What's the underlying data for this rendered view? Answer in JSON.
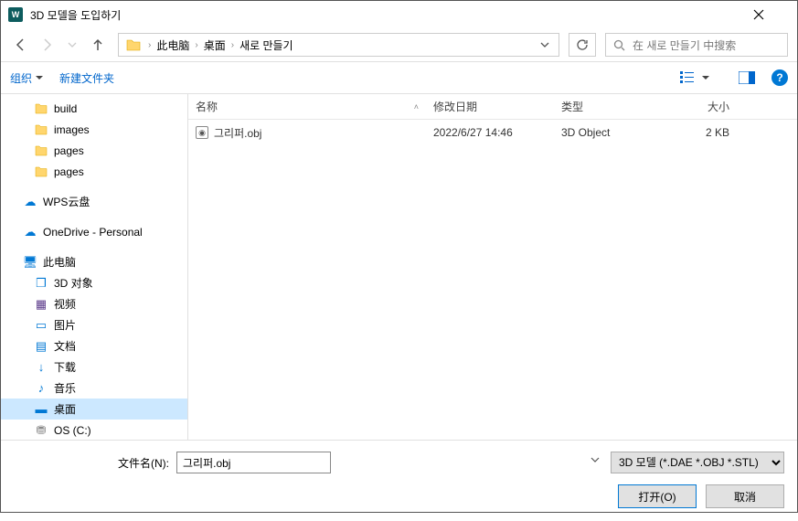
{
  "window": {
    "title": "3D 모델을 도입하기"
  },
  "nav": {
    "crumbs": [
      "此电脑",
      "桌面",
      "새로 만들기"
    ]
  },
  "search": {
    "placeholder": "在 새로 만들기 中搜索"
  },
  "toolbar": {
    "organize": "组织",
    "newfolder": "新建文件夹"
  },
  "columns": {
    "name": "名称",
    "date": "修改日期",
    "type": "类型",
    "size": "大小"
  },
  "sidebar": {
    "folders": [
      "build",
      "images",
      "pages",
      "pages"
    ],
    "wps": "WPS云盘",
    "onedrive": "OneDrive - Personal",
    "thispc": "此电脑",
    "pcitems": [
      {
        "label": "3D 对象",
        "cls": "obj3d",
        "glyph": "❒"
      },
      {
        "label": "视频",
        "cls": "video",
        "glyph": "▦"
      },
      {
        "label": "图片",
        "cls": "pic",
        "glyph": "▭"
      },
      {
        "label": "文档",
        "cls": "doc",
        "glyph": "▤"
      },
      {
        "label": "下载",
        "cls": "dl",
        "glyph": "↓"
      },
      {
        "label": "音乐",
        "cls": "music",
        "glyph": "♪"
      },
      {
        "label": "桌面",
        "cls": "desk",
        "glyph": "▬",
        "selected": true
      },
      {
        "label": "OS (C:)",
        "cls": "drive",
        "glyph": "⛃"
      }
    ]
  },
  "files": [
    {
      "name": "그리퍼.obj",
      "date": "2022/6/27 14:46",
      "type": "3D Object",
      "size": "2 KB"
    }
  ],
  "footer": {
    "filename_label": "文件名(N):",
    "filename_value": "그리퍼.obj",
    "filter": "3D 모델 (*.DAE *.OBJ *.STL)",
    "open": "打开(O)",
    "cancel": "取消"
  }
}
